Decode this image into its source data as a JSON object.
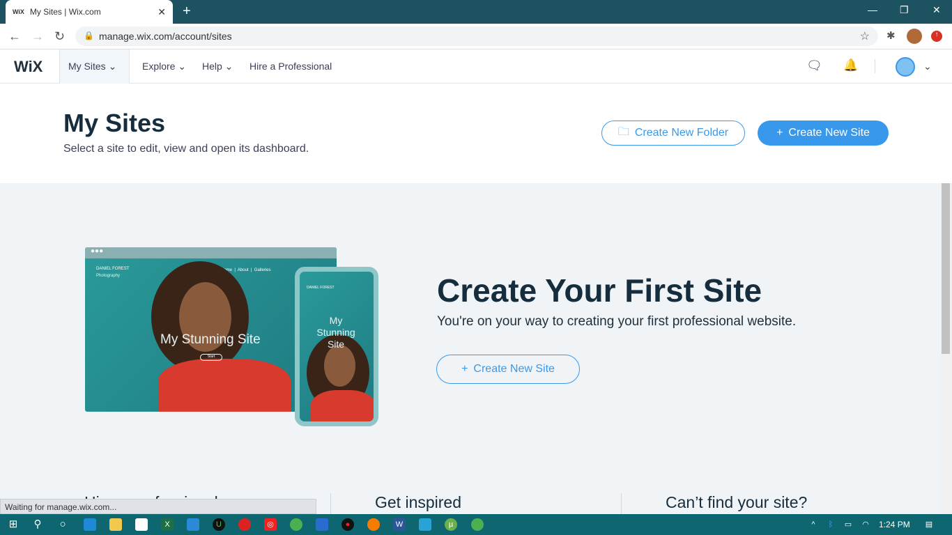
{
  "browser": {
    "tab_title": "My Sites | Wix.com",
    "tab_favicon": "WiX",
    "url": "manage.wix.com/account/sites",
    "status": "Waiting for manage.wix.com..."
  },
  "nav": {
    "logo": "WiX",
    "items": [
      "My Sites",
      "Explore",
      "Help",
      "Hire a Professional"
    ]
  },
  "header": {
    "title": "My Sites",
    "subtitle": "Select a site to edit, view and open its dashboard.",
    "create_folder": "Create New Folder",
    "create_site": "Create New Site"
  },
  "hero": {
    "title": "Create Your First Site",
    "subtitle": "You're on your way to creating your first professional website.",
    "button": "Create New Site",
    "mock": {
      "brand": "DANIEL FOREST",
      "brand_sub": "Photography",
      "menu": "Home  |  About  |  Galleries",
      "site_name": "My Stunning Site",
      "cta": "Start",
      "phone_site_name": "My Stunning Site"
    }
  },
  "sections": [
    "Hire a professional",
    "Get inspired",
    "Can’t find your site?"
  ],
  "taskbar": {
    "time": "1:24 PM"
  },
  "colors": {
    "accent": "#3899ec",
    "tabbar": "#1d5360",
    "taskbar": "#0e6770"
  }
}
